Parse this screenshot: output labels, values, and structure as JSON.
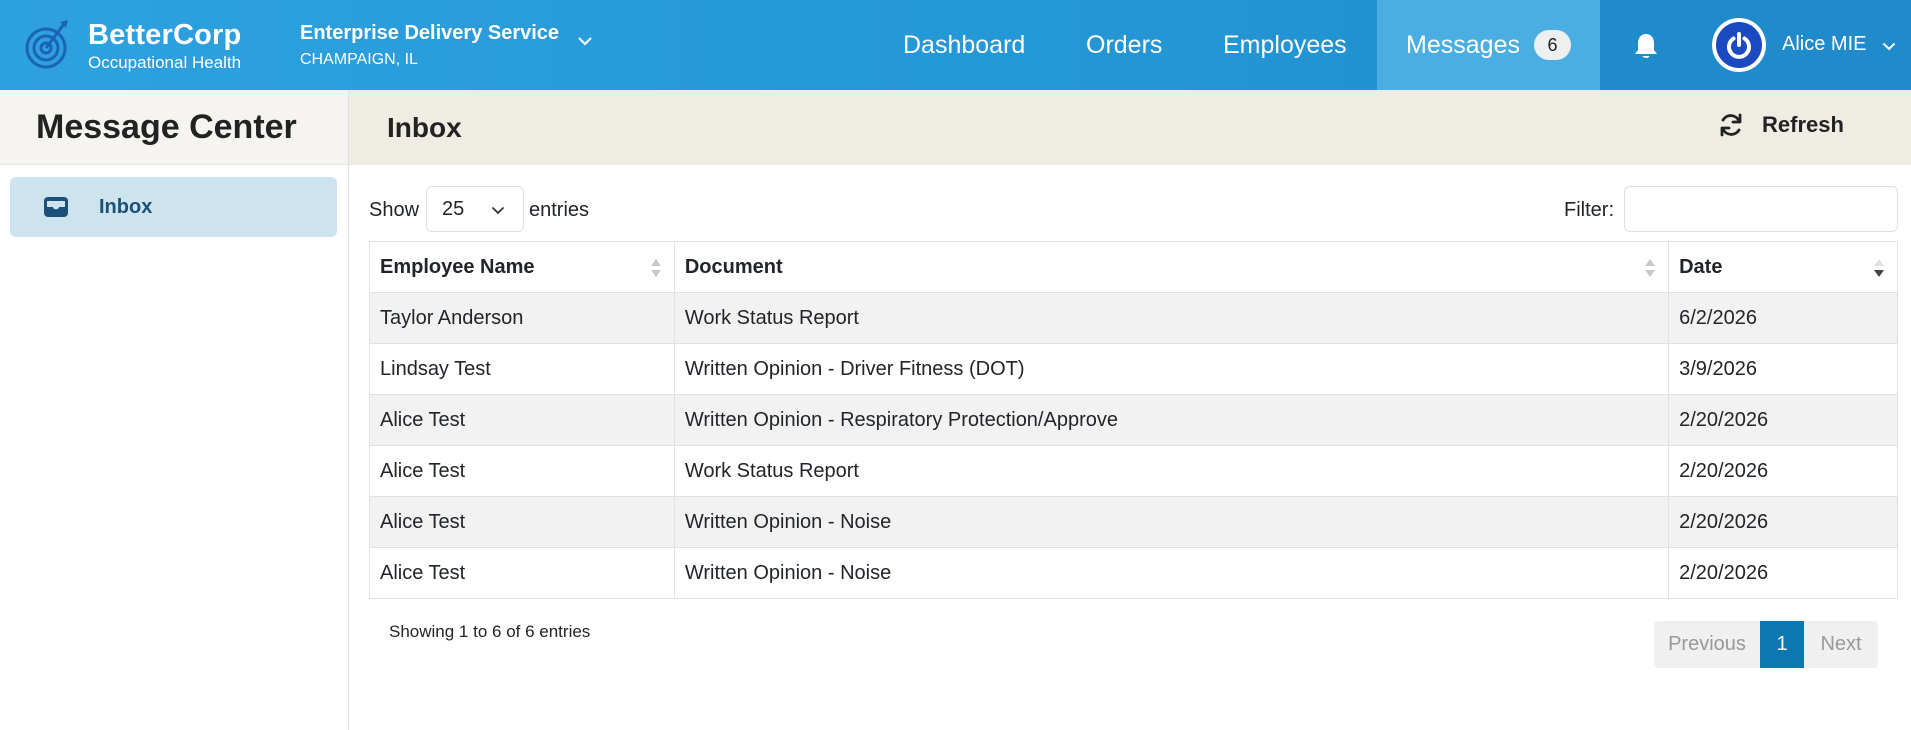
{
  "brand": {
    "name": "BetterCorp",
    "subtitle": "Occupational Health"
  },
  "org": {
    "name": "Enterprise Delivery Service",
    "location": "CHAMPAIGN, IL"
  },
  "nav": {
    "items": [
      {
        "label": "Dashboard"
      },
      {
        "label": "Orders"
      },
      {
        "label": "Employees"
      },
      {
        "label": "Messages",
        "badge": "6",
        "active": true
      }
    ]
  },
  "user": {
    "name": "Alice MIE",
    "icons": [
      "bell-icon",
      "power-icon",
      "chevron-down-icon"
    ]
  },
  "sidebar": {
    "title": "Message Center",
    "items": [
      {
        "label": "Inbox",
        "icon": "inbox-icon",
        "active": true
      }
    ]
  },
  "main": {
    "title": "Inbox",
    "refresh_label": "Refresh",
    "show_label": "Show",
    "page_length": "25",
    "entries_label": "entries",
    "filter_label": "Filter:",
    "filter_value": ""
  },
  "table": {
    "columns": [
      {
        "label": "Employee Name"
      },
      {
        "label": "Document"
      },
      {
        "label": "Date"
      }
    ],
    "rows": [
      {
        "employee": "Taylor Anderson",
        "document": "Work Status Report",
        "date": "6/2/2026"
      },
      {
        "employee": "Lindsay Test",
        "document": "Written Opinion - Driver Fitness (DOT)",
        "date": "3/9/2026"
      },
      {
        "employee": "Alice Test",
        "document": "Written Opinion - Respiratory Protection/Approve",
        "date": "2/20/2026"
      },
      {
        "employee": "Alice Test",
        "document": "Work Status Report",
        "date": "2/20/2026"
      },
      {
        "employee": "Alice Test",
        "document": "Written Opinion - Noise",
        "date": "2/20/2026"
      },
      {
        "employee": "Alice Test",
        "document": "Written Opinion - Noise",
        "date": "2/20/2026"
      }
    ]
  },
  "pagination": {
    "info": "Showing 1 to 6 of 6 entries",
    "previous": "Previous",
    "current": "1",
    "next": "Next"
  },
  "colors": {
    "navbar": "#2497d6",
    "nav_active": "#4aaee2",
    "sidebar_active": "#cde4ee",
    "header_band": "#efece4",
    "pager_active": "#0d78b0"
  }
}
